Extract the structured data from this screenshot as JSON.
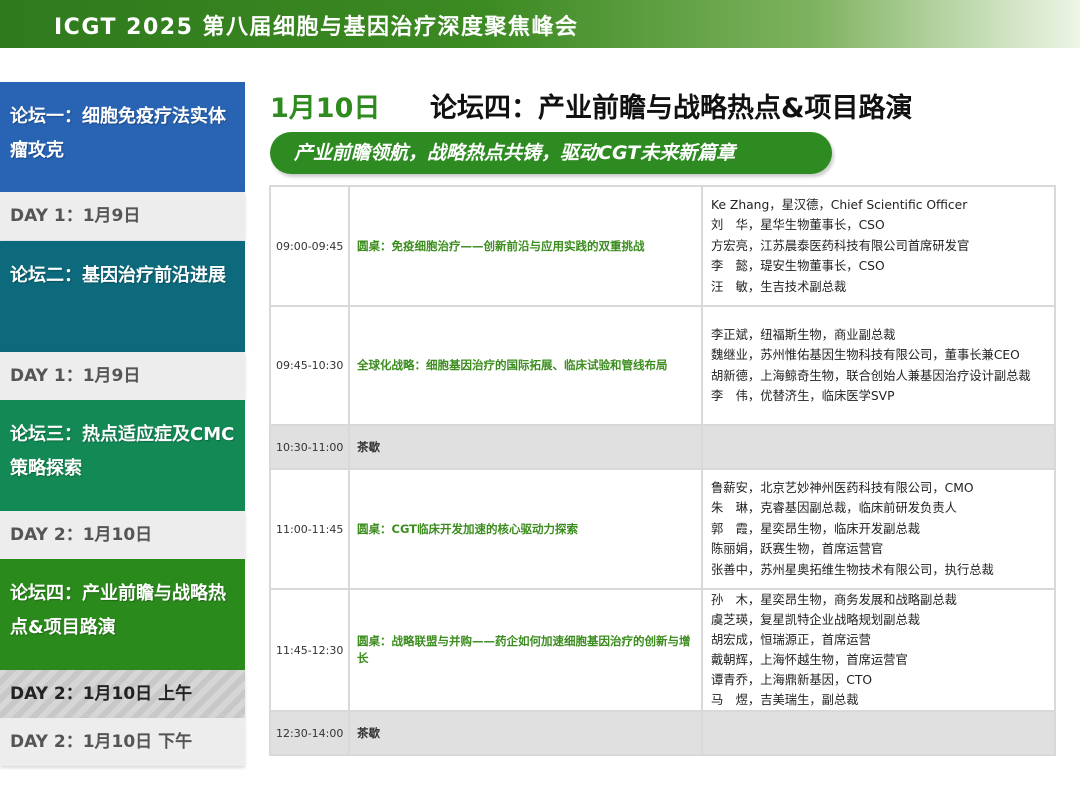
{
  "header": {
    "title": "ICGT 2025 第八届细胞与基因治疗深度聚焦峰会"
  },
  "sidebar": {
    "items": [
      {
        "forum": "论坛一：细胞免疫疗法实体瘤攻克",
        "day": "DAY 1：1月9日",
        "color": "#2863b4"
      },
      {
        "forum": "论坛二：基因治疗前沿进展",
        "day": "DAY 1：1月9日",
        "color": "#0c6a7c"
      },
      {
        "forum": "论坛三：热点适应症及CMC策略探索",
        "day": "DAY 2：1月10日",
        "color": "#138a55"
      },
      {
        "forum": "论坛四：产业前瞻与战略热点&项目路演",
        "day_am": "DAY 2：1月10日 上午",
        "day_pm": "DAY 2：1月10日 下午",
        "color": "#2b8a1c"
      }
    ]
  },
  "main": {
    "date": "1月10日",
    "title": "论坛四：产业前瞻与战略热点&项目路演",
    "banner": "产业前瞻领航，战略热点共铸，驱动CGT未来新篇章"
  },
  "schedule": [
    {
      "time": "09:00-09:45",
      "topic": "圆桌：免疫细胞治疗——创新前沿与应用实践的双重挑战",
      "speakers": [
        "Ke Zhang，星汉德，Chief Scientific Officer",
        "刘　华，星华生物董事长，CSO",
        "方宏亮，江苏晨泰医药科技有限公司首席研发官",
        "李　懿，瑅安生物董事长，CSO",
        "汪　敏，生吉技术副总裁"
      ]
    },
    {
      "time": "09:45-10:30",
      "topic": "全球化战略：细胞基因治疗的国际拓展、临床试验和管线布局",
      "speakers": [
        "李正斌，纽福斯生物，商业副总裁",
        "魏继业，苏州惟佑基因生物科技有限公司，董事长兼CEO",
        "胡新德，上海鲸奇生物，联合创始人兼基因治疗设计副总裁",
        "李　伟，优替济生，临床医学SVP"
      ]
    },
    {
      "time": "10:30-11:00",
      "topic": "茶歇",
      "speakers": []
    },
    {
      "time": "11:00-11:45",
      "topic": "圆桌：CGT临床开发加速的核心驱动力探索",
      "speakers": [
        "鲁薪安，北京艺妙神州医药科技有限公司，CMO",
        "朱　琳，克睿基因副总裁，临床前研发负责人",
        "郭　霞，星奕昂生物，临床开发副总裁",
        "陈丽娟，跃赛生物，首席运营官",
        "张善中，苏州星奥拓维生物技术有限公司，执行总裁"
      ]
    },
    {
      "time": "11:45-12:30",
      "topic": "圆桌：战略联盟与并购——药企如何加速细胞基因治疗的创新与增长",
      "speakers": [
        "孙　木，星奕昂生物，商务发展和战略副总裁",
        "虞芝瑛，复星凯特企业战略规划副总裁",
        "胡宏成，恒瑞源正，首席运营",
        "戴朝辉，上海怀越生物，首席运营官",
        "谭青乔，上海鼎新基因，CTO",
        "马　煜，吉美瑞生，副总裁"
      ]
    },
    {
      "time": "12:30-14:00",
      "topic": "茶歇",
      "speakers": []
    }
  ]
}
